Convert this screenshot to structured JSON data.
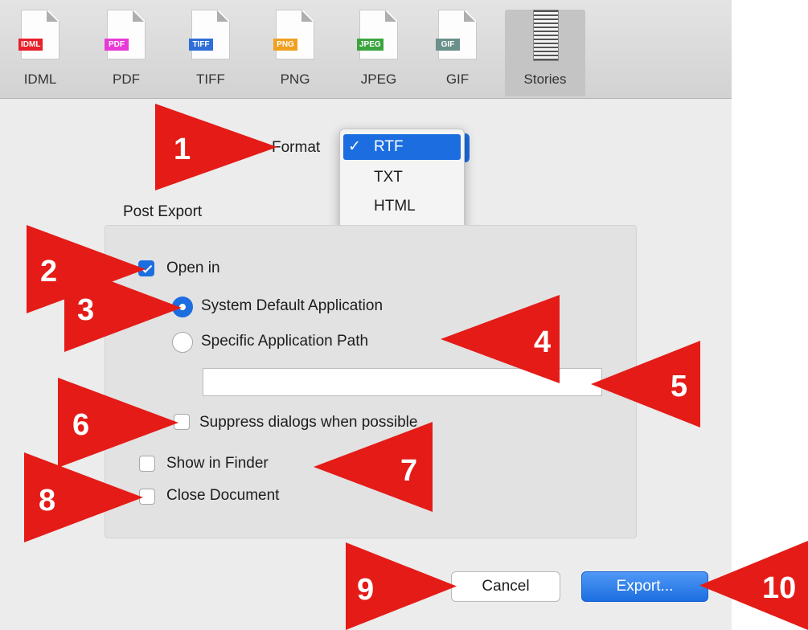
{
  "toolbar": {
    "tabs": [
      {
        "label": "IDML",
        "badge": "IDML",
        "badge_color": "#e8202a"
      },
      {
        "label": "PDF",
        "badge": "PDF",
        "badge_color": "#e83ad6"
      },
      {
        "label": "TIFF",
        "badge": "TIFF",
        "badge_color": "#2f6ed8"
      },
      {
        "label": "PNG",
        "badge": "PNG",
        "badge_color": "#f0a020"
      },
      {
        "label": "JPEG",
        "badge": "JPEG",
        "badge_color": "#3aa540"
      },
      {
        "label": "GIF",
        "badge": "GIF",
        "badge_color": "#6b8f8a"
      },
      {
        "label": "Stories",
        "selected": true
      }
    ]
  },
  "format": {
    "label": "Format",
    "options": [
      {
        "label": "RTF",
        "selected": true
      },
      {
        "label": "TXT"
      },
      {
        "label": "HTML"
      }
    ],
    "check_mark": "✓"
  },
  "post_export": {
    "title": "Post Export",
    "open_in": {
      "label": "Open in",
      "checked": true
    },
    "system_default": {
      "label": "System Default Application",
      "selected": true
    },
    "specific_path": {
      "label": "Specific Application Path",
      "selected": false
    },
    "app_path_value": "",
    "suppress_dialogs": {
      "label": "Suppress dialogs when possible",
      "checked": false
    },
    "show_in_finder": {
      "label": "Show in Finder",
      "checked": false
    },
    "close_document": {
      "label": "Close Document",
      "checked": false
    }
  },
  "buttons": {
    "cancel": "Cancel",
    "export": "Export..."
  },
  "annotations": [
    "1",
    "2",
    "3",
    "4",
    "5",
    "6",
    "7",
    "8",
    "9",
    "10"
  ],
  "colors": {
    "accent": "#1c6ee0",
    "annotation_red": "#e41b17"
  }
}
